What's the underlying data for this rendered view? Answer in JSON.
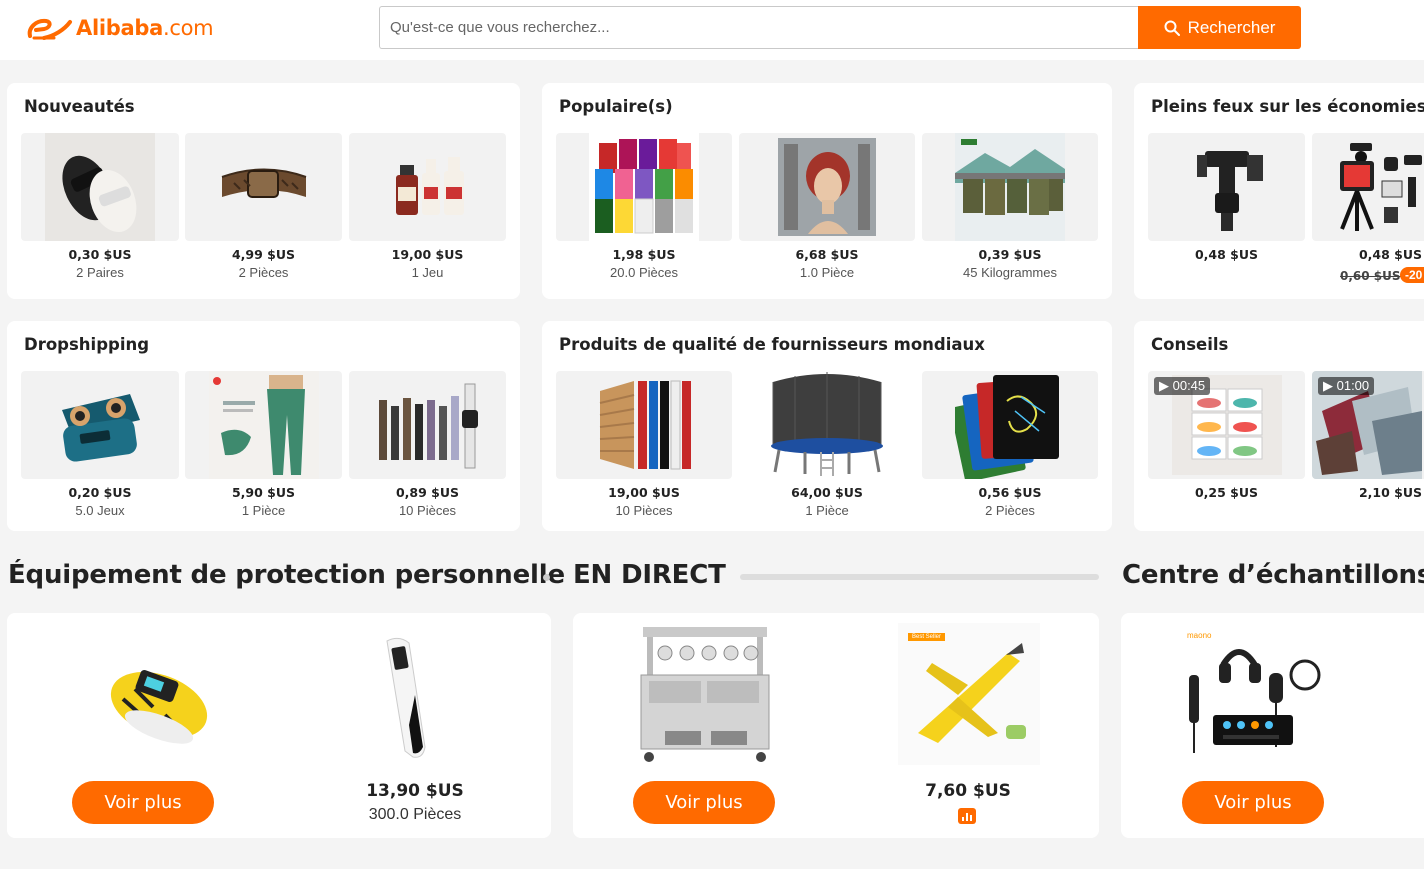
{
  "header": {
    "logo_text": "Alibaba",
    "logo_suffix": ".com",
    "search_placeholder": "Qu'est-ce que vous recherchez...",
    "search_button": "Rechercher"
  },
  "cards": {
    "nouveautes": {
      "title": "Nouveautés",
      "items": [
        {
          "price": "0,30 $US",
          "unit": "2 Paires",
          "icon": "slippers-image"
        },
        {
          "price": "4,99 $US",
          "unit": "2 Pièces",
          "icon": "belt-image"
        },
        {
          "price": "19,00 $US",
          "unit": "1 Jeu",
          "icon": "bottles-image"
        }
      ]
    },
    "populaire": {
      "title": "Populaire(s)",
      "items": [
        {
          "price": "1,98 $US",
          "unit": "20.0 Pièces",
          "icon": "hoodies-image"
        },
        {
          "price": "6,68 $US",
          "unit": "1.0 Pièce",
          "icon": "wig-image"
        },
        {
          "price": "0,39 $US",
          "unit": "45 Kilogrammes",
          "icon": "shorts-image"
        }
      ]
    },
    "economies": {
      "title": "Pleins feux sur les économies",
      "items": [
        {
          "price": "0,48 $US",
          "unit": "",
          "icon": "sprinkler-image"
        },
        {
          "price": "0,48 $US",
          "old_price": "0,60 $US",
          "discount": "-20",
          "icon": "vlog-kit-image"
        }
      ]
    },
    "dropshipping": {
      "title": "Dropshipping",
      "items": [
        {
          "price": "0,20 $US",
          "unit": "5.0 Jeux",
          "icon": "earbuds-image"
        },
        {
          "price": "5,90 $US",
          "unit": "1 Pièce",
          "icon": "leggings-image"
        },
        {
          "price": "0,89 $US",
          "unit": "10 Pièces",
          "icon": "watch-bands-image"
        }
      ]
    },
    "qualite": {
      "title": "Produits de qualité de fournisseurs mondiaux",
      "items": [
        {
          "price": "19,00 $US",
          "unit": "10 Pièces",
          "icon": "panels-image"
        },
        {
          "price": "64,00 $US",
          "unit": "1 Pièce",
          "icon": "trampoline-image"
        },
        {
          "price": "0,56 $US",
          "unit": "2 Pièces",
          "icon": "drawing-tablets-image"
        }
      ]
    },
    "conseils": {
      "title": "Conseils",
      "items": [
        {
          "price": "0,25 $US",
          "duration": "00:45",
          "icon": "shoe-boxes-image"
        },
        {
          "price": "2,10 $US",
          "duration": "01:00",
          "icon": "bags-image"
        }
      ]
    }
  },
  "sections": {
    "epi": {
      "title": "Équipement de protection personnelle",
      "button": "Voir plus",
      "price": "13,90 $US",
      "unit": "300.0 Pièces"
    },
    "live": {
      "title": "EN DIRECT",
      "button": "Voir plus",
      "price": "7,60 $US",
      "product_badge": "Best Seller"
    },
    "samples": {
      "title": "Centre d’échantillons",
      "button": "Voir plus",
      "brand": "maono"
    }
  },
  "colors": {
    "accent": "#ff6a00",
    "background": "#f4f4f4",
    "card": "#ffffff",
    "text": "#222222"
  }
}
